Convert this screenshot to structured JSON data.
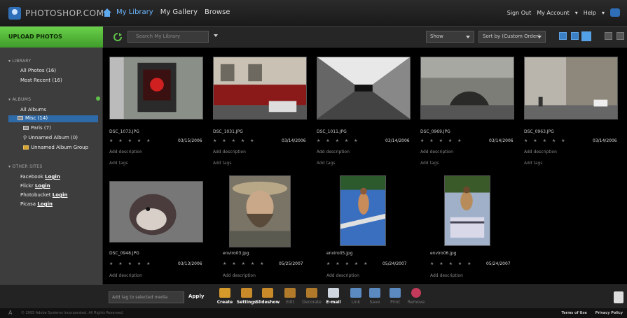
{
  "header": {
    "brand": "PHOTOSHOP.COM",
    "nav": [
      "My Library",
      "My Gallery",
      "Browse"
    ],
    "right": [
      "Sign Out",
      "My Account",
      "Help"
    ]
  },
  "toolbar": {
    "upload_label": "UPLOAD PHOTOS",
    "search_placeholder": "Search My Library",
    "show_label": "Show",
    "sort_label": "Sort by (Custom Order)"
  },
  "sidebar": {
    "library_heading": "LIBRARY",
    "library_items": [
      "All Photos (16)",
      "Most Recent (16)"
    ],
    "albums_heading": "ALBUMS",
    "albums_all": "All Albums",
    "albums": [
      "Misc (14)",
      "Paris (7)",
      "Unnamed Album (0)",
      "Unnamed Album Group"
    ],
    "other_heading": "OTHER SITES",
    "sites": [
      {
        "name": "Facebook",
        "action": "Login"
      },
      {
        "name": "Flickr",
        "action": "Login"
      },
      {
        "name": "Photobucket",
        "action": "Login"
      },
      {
        "name": "Picasa",
        "action": "Login"
      }
    ]
  },
  "photos": [
    {
      "filename": "DSC_1073.JPG",
      "date": "03/15/2006",
      "desc": "Add description",
      "tags": "Add tags",
      "stars": "★ ★ ★ ★ ★"
    },
    {
      "filename": "DSC_1031.JPG",
      "date": "03/14/2006",
      "desc": "Add description",
      "tags": "Add tags",
      "stars": "★ ★ ★ ★ ★"
    },
    {
      "filename": "DSC_1011.JPG",
      "date": "03/14/2006",
      "desc": "Add description",
      "tags": "Add tags",
      "stars": "★ ★ ★ ★ ★"
    },
    {
      "filename": "DSC_0969.JPG",
      "date": "03/14/2006",
      "desc": "Add description",
      "tags": "Add tags",
      "stars": "★ ★ ★ ★ ★"
    },
    {
      "filename": "DSC_0963.JPG",
      "date": "03/14/2006",
      "desc": "Add description",
      "tags": "Add tags",
      "stars": "★ ★ ★ ★ ★"
    },
    {
      "filename": "DSC_0948.JPG",
      "date": "03/13/2006",
      "desc": "Add description",
      "tags": "",
      "stars": "★ ★ ★ ★ ★"
    },
    {
      "filename": "enviro03.jpg",
      "date": "05/25/2007",
      "desc": "Add description",
      "tags": "",
      "stars": "★ ★ ★ ★ ★"
    },
    {
      "filename": "enviro05.jpg",
      "date": "05/24/2007",
      "desc": "Add description",
      "tags": "",
      "stars": "★ ★ ★ ★ ★"
    },
    {
      "filename": "enviro06.jpg",
      "date": "05/24/2007",
      "desc": "Add description",
      "tags": "",
      "stars": "★ ★ ★ ★ ★"
    }
  ],
  "bottom": {
    "tag_placeholder": "Add tag to selected media",
    "apply_label": "Apply",
    "tools": [
      {
        "label": "Create",
        "icon": "create-icon",
        "enabled": true,
        "color": "#d69a2a"
      },
      {
        "label": "Settings",
        "icon": "settings-icon",
        "enabled": true,
        "color": "#c98a2a"
      },
      {
        "label": "Slideshow",
        "icon": "slideshow-icon",
        "enabled": true,
        "color": "#c98a2a"
      },
      {
        "label": "Edit",
        "icon": "edit-icon",
        "enabled": false,
        "color": "#b07a2a"
      },
      {
        "label": "Decorate",
        "icon": "decorate-icon",
        "enabled": false,
        "color": "#b07a2a"
      },
      {
        "label": "E-mail",
        "icon": "email-icon",
        "enabled": true,
        "color": "#cfd6e0"
      },
      {
        "label": "Link",
        "icon": "link-icon",
        "enabled": false,
        "color": "#5a8ac0"
      },
      {
        "label": "Save",
        "icon": "save-icon",
        "enabled": false,
        "color": "#5a8ac0"
      },
      {
        "label": "Print",
        "icon": "print-icon",
        "enabled": false,
        "color": "#5a8ac0"
      },
      {
        "label": "Remove",
        "icon": "remove-icon",
        "enabled": false,
        "color": "#c43a5a"
      }
    ]
  },
  "footer": {
    "copyright": "© 2005 Adobe Systems Incorporated. All Rights Reserved.",
    "links": [
      "Terms of Use",
      "Privacy Policy"
    ]
  }
}
